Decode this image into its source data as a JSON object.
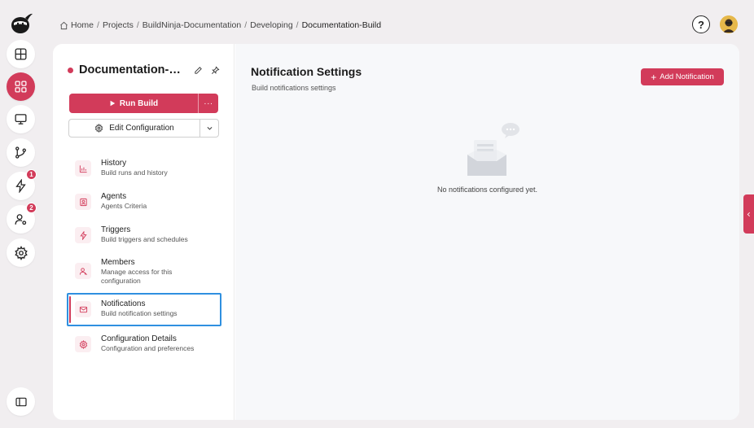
{
  "breadcrumb": {
    "items": [
      "Home",
      "Projects",
      "BuildNinja-Documentation",
      "Developing",
      "Documentation-Build"
    ],
    "separator": "/"
  },
  "rail": {
    "items": [
      {
        "name": "dashboard",
        "icon": "layout-grid-icon",
        "badge": null
      },
      {
        "name": "projects",
        "icon": "grid-apps-icon",
        "badge": null,
        "active": true
      },
      {
        "name": "agents",
        "icon": "monitor-icon",
        "badge": null
      },
      {
        "name": "vcs",
        "icon": "git-branch-icon",
        "badge": null
      },
      {
        "name": "builds",
        "icon": "lightning-icon",
        "badge": "1"
      },
      {
        "name": "users",
        "icon": "user-gear-icon",
        "badge": "2"
      },
      {
        "name": "settings",
        "icon": "gear-icon",
        "badge": null
      }
    ]
  },
  "config": {
    "title": "Documentation-Build",
    "run_label": "Run Build",
    "more_label": "···",
    "edit_label": "Edit Configuration"
  },
  "nav": [
    {
      "label": "History",
      "sub": "Build runs and history",
      "icon": "chart-icon"
    },
    {
      "label": "Agents",
      "sub": "Agents Criteria",
      "icon": "agent-icon"
    },
    {
      "label": "Triggers",
      "sub": "Build triggers and schedules",
      "icon": "lightning-icon"
    },
    {
      "label": "Members",
      "sub": "Manage access for this configuration",
      "icon": "members-icon"
    },
    {
      "label": "Notifications",
      "sub": "Build notification settings",
      "icon": "mail-icon",
      "selected": true
    },
    {
      "label": "Configuration Details",
      "sub": "Configuration and preferences",
      "icon": "gear-icon"
    }
  ],
  "main": {
    "title": "Notification Settings",
    "subtitle": "Build notifications settings",
    "add_label": "Add Notification",
    "empty_text": "No notifications configured yet."
  },
  "colors": {
    "accent": "#d23b5a",
    "selection": "#2f90e0"
  }
}
